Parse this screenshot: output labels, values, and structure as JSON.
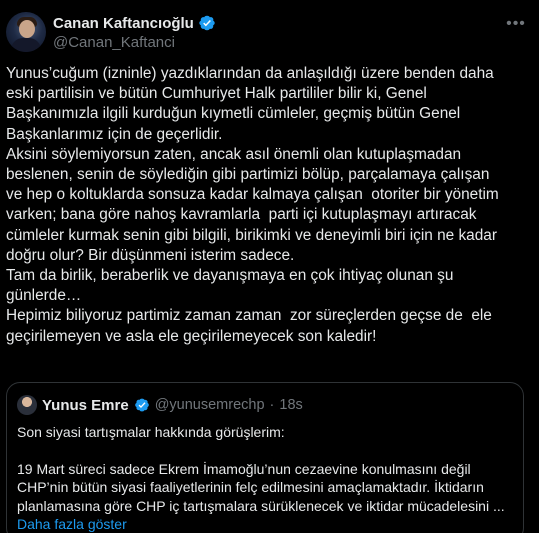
{
  "tweet": {
    "author": {
      "name": "Canan Kaftancıoğlu",
      "handle": "@Canan_Kaftanci"
    },
    "more_icon": "more-horizontal-icon",
    "lines": [
      "Yunus’cuğum (izninle) yazdıklarından da anlaşıldığı üzere benden daha",
      "eski partilisin ve bütün Cumhuriyet Halk partililer bilir ki, Genel",
      "Başkanımızla ilgili kurduğun kıymetli cümleler, geçmiş bütün Genel",
      "Başkanlarımız için de geçerlidir.",
      "Aksini söylemiyorsun zaten, ancak asıl önemli olan kutuplaşmadan",
      "beslenen, senin de söylediğin gibi partimizi bölüp, parçalamaya çalışan",
      "ve hep o koltuklarda sonsuza kadar kalmaya çalışan  otoriter bir yönetim",
      "varken; bana göre nahoş kavramlarla  parti içi kutuplaşmayı artıracak",
      "cümleler kurmak senin gibi bilgili, birikimki ve deneyimli biri için ne kadar",
      "doğru olur? Bir düşünmeni isterim sadece.",
      "Tam da birlik, beraberlik ve dayanışmaya en çok ihtiyaç olunan şu",
      "günlerde…",
      "Hepimiz biliyoruz partimiz zaman zaman  zor süreçlerden geçse de  ele",
      "geçirilemeyen ve asla ele geçirilemeyecek son kaledir!"
    ]
  },
  "quote": {
    "name": "Yunus Emre",
    "handle": "@yunusemrechp",
    "separator": "·",
    "time": "18s",
    "first_line": "Son siyasi tartışmalar hakkında görüşlerim:",
    "lines": [
      "19 Mart süreci sadece Ekrem İmamoğlu’nun cezaevine konulmasını değil",
      "CHP’nin bütün siyasi faaliyetlerinin felç edilmesini amaçlamaktadır. İktidarın",
      "planlamasına göre CHP iç tartışmalara sürüklenecek ve iktidar mücadelesini ..."
    ],
    "show_more": "Daha fazla göster"
  },
  "colors": {
    "background": "#000000",
    "text": "#e7e9ea",
    "muted": "#71767b",
    "link": "#1d9bf0",
    "border": "#2f3336"
  }
}
